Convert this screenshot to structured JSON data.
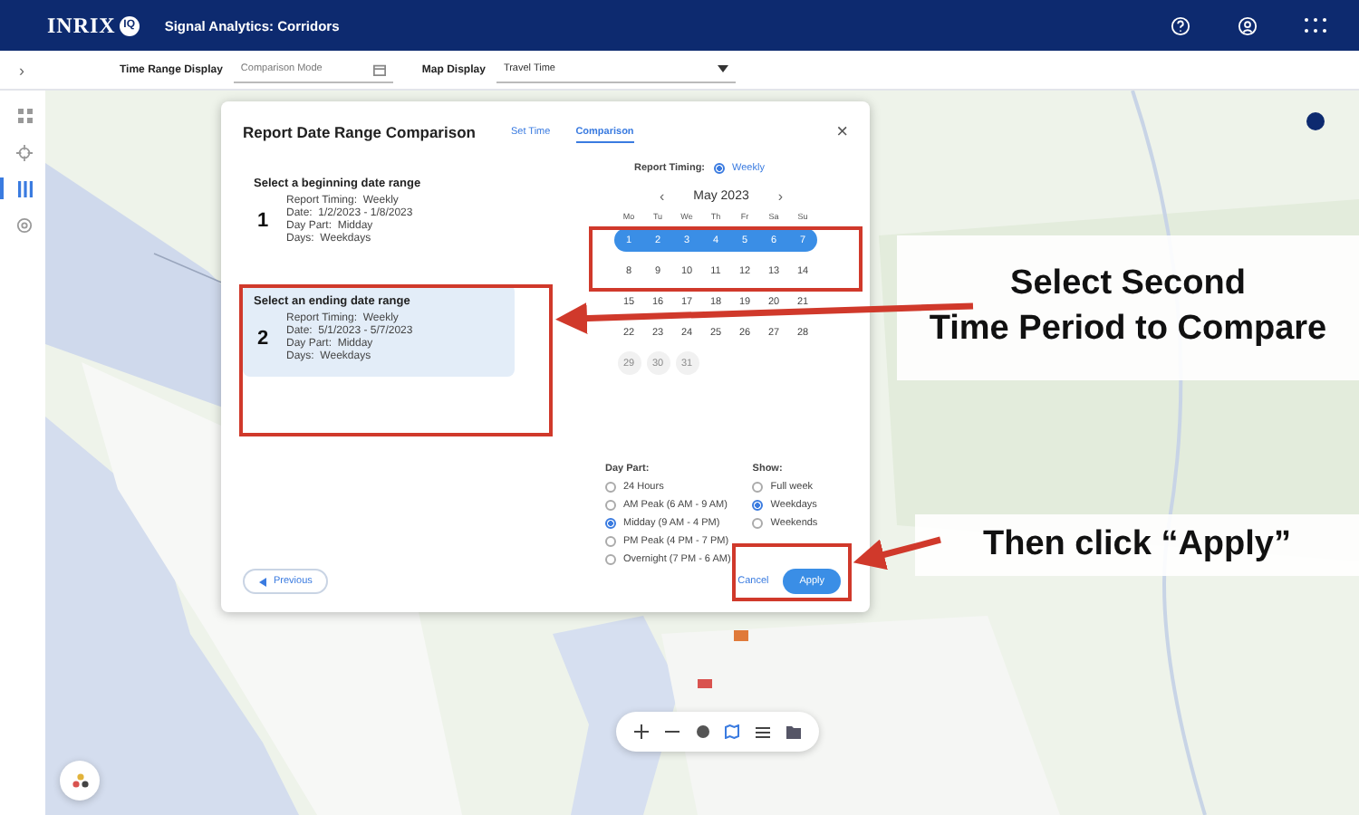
{
  "header": {
    "logo": "INRIX",
    "logo_badge": "IQ",
    "title": "Signal Analytics: Corridors"
  },
  "toolbar": {
    "expand": "›",
    "time_range_label": "Time Range Display",
    "time_range_value": "Comparison Mode",
    "map_display_label": "Map Display",
    "map_display_value": "Travel Time"
  },
  "sidebar": {
    "items": [
      {
        "kind": "grid",
        "selected": false
      },
      {
        "kind": "crosshair",
        "selected": false
      },
      {
        "kind": "bars",
        "selected": true
      },
      {
        "kind": "gear",
        "selected": false
      }
    ]
  },
  "dialog": {
    "title": "Report Date Range Comparison",
    "close": "×",
    "tabs": [
      {
        "label": "Set Time",
        "selected": false
      },
      {
        "label": "Comparison",
        "selected": true
      }
    ],
    "ranges": [
      {
        "number": "1",
        "heading": "Select a beginning date range",
        "selected": false,
        "lines": [
          "Report Timing:  Weekly",
          "Date:  1/2/2023 - 1/8/2023",
          "Day Part:  Midday",
          "Days:  Weekdays"
        ]
      },
      {
        "number": "2",
        "heading": "Select an ending date range",
        "selected": true,
        "lines": [
          "Report Timing:  Weekly",
          "Date:  5/1/2023 - 5/7/2023",
          "Day Part:  Midday",
          "Days:  Weekdays"
        ]
      }
    ],
    "report_timing": {
      "label": "Report Timing:",
      "option": "Weekly",
      "selected": true
    },
    "calendar": {
      "prev": "‹",
      "month": "May 2023",
      "next": "›",
      "weekdays": [
        "Mo",
        "Tu",
        "We",
        "Th",
        "Fr",
        "Sa",
        "Su"
      ],
      "weeks": [
        [
          {
            "day": "1",
            "selected": true,
            "disabled": false
          },
          {
            "day": "2",
            "selected": true,
            "disabled": false
          },
          {
            "day": "3",
            "selected": true,
            "disabled": false
          },
          {
            "day": "4",
            "selected": true,
            "disabled": false
          },
          {
            "day": "5",
            "selected": true,
            "disabled": false
          },
          {
            "day": "6",
            "selected": true,
            "disabled": false
          },
          {
            "day": "7",
            "selected": true,
            "disabled": false
          }
        ],
        [
          {
            "day": "8",
            "selected": false,
            "disabled": false
          },
          {
            "day": "9",
            "selected": false,
            "disabled": false
          },
          {
            "day": "10",
            "selected": false,
            "disabled": false
          },
          {
            "day": "11",
            "selected": false,
            "disabled": false
          },
          {
            "day": "12",
            "selected": false,
            "disabled": false
          },
          {
            "day": "13",
            "selected": false,
            "disabled": false
          },
          {
            "day": "14",
            "selected": false,
            "disabled": false
          }
        ],
        [
          {
            "day": "15",
            "selected": false,
            "disabled": false
          },
          {
            "day": "16",
            "selected": false,
            "disabled": false
          },
          {
            "day": "17",
            "selected": false,
            "disabled": false
          },
          {
            "day": "18",
            "selected": false,
            "disabled": false
          },
          {
            "day": "19",
            "selected": false,
            "disabled": false
          },
          {
            "day": "20",
            "selected": false,
            "disabled": false
          },
          {
            "day": "21",
            "selected": false,
            "disabled": false
          }
        ],
        [
          {
            "day": "22",
            "selected": false,
            "disabled": false
          },
          {
            "day": "23",
            "selected": false,
            "disabled": false
          },
          {
            "day": "24",
            "selected": false,
            "disabled": false
          },
          {
            "day": "25",
            "selected": false,
            "disabled": false
          },
          {
            "day": "26",
            "selected": false,
            "disabled": false
          },
          {
            "day": "27",
            "selected": false,
            "disabled": false
          },
          {
            "day": "28",
            "selected": false,
            "disabled": false
          }
        ],
        [
          {
            "day": "29",
            "selected": false,
            "disabled": true
          },
          {
            "day": "30",
            "selected": false,
            "disabled": true
          },
          {
            "day": "31",
            "selected": false,
            "disabled": true
          }
        ]
      ]
    },
    "day_part": {
      "label": "Day Part:",
      "options": [
        {
          "label": "24 Hours",
          "selected": false
        },
        {
          "label": "AM Peak (6 AM - 9 AM)",
          "selected": false
        },
        {
          "label": "Midday (9 AM - 4 PM)",
          "selected": true
        },
        {
          "label": "PM Peak (4 PM - 7 PM)",
          "selected": false
        },
        {
          "label": "Overnight (7 PM - 6 AM)",
          "selected": false
        }
      ]
    },
    "show": {
      "label": "Show:",
      "options": [
        {
          "label": "Full week",
          "selected": false
        },
        {
          "label": "Weekdays",
          "selected": true
        },
        {
          "label": "Weekends",
          "selected": false
        }
      ]
    },
    "previous": "Previous",
    "cancel": "Cancel",
    "apply": "Apply"
  },
  "annotations": [
    {
      "lines": [
        "Select Second",
        "Time Period to Compare"
      ]
    },
    {
      "lines": [
        "Then click “Apply”"
      ]
    }
  ]
}
